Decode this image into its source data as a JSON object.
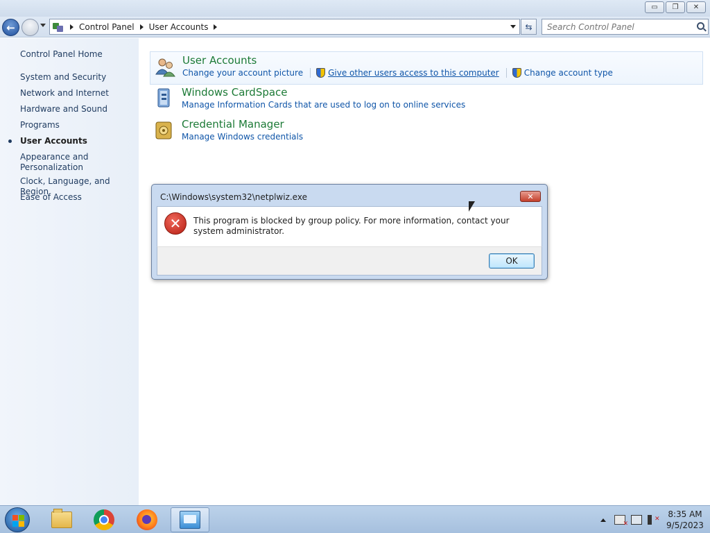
{
  "window": {
    "caption_buttons": {
      "minimize": "▭",
      "restore": "❐",
      "close": "✕"
    }
  },
  "navbar": {
    "breadcrumbs": [
      "Control Panel",
      "User Accounts"
    ],
    "search_placeholder": "Search Control Panel",
    "refresh_glyph": "⇆"
  },
  "sidebar": {
    "home": "Control Panel Home",
    "items": [
      {
        "label": "System and Security",
        "active": false
      },
      {
        "label": "Network and Internet",
        "active": false
      },
      {
        "label": "Hardware and Sound",
        "active": false
      },
      {
        "label": "Programs",
        "active": false
      },
      {
        "label": "User Accounts",
        "active": true
      },
      {
        "label": "Appearance and Personalization",
        "active": false
      },
      {
        "label": "Clock, Language, and Region",
        "active": false
      },
      {
        "label": "Ease of Access",
        "active": false
      }
    ]
  },
  "main": {
    "categories": [
      {
        "title": "User Accounts",
        "links": [
          "Change your account picture",
          "Give other users access to this computer",
          "Change account type"
        ]
      },
      {
        "title": "Windows CardSpace",
        "links": [
          "Manage Information Cards that are used to log on to online services"
        ]
      },
      {
        "title": "Credential Manager",
        "links": [
          "Manage Windows credentials"
        ]
      }
    ]
  },
  "dialog": {
    "title": "C:\\Windows\\system32\\netplwiz.exe",
    "message": "This program is blocked by group policy. For more information, contact your system administrator.",
    "ok_label": "OK",
    "close_glyph": "✕",
    "error_glyph": "✕"
  },
  "taskbar": {
    "apps": [
      "windows-explorer",
      "google-chrome",
      "firefox",
      "control-panel"
    ],
    "clock_time": "8:35 AM",
    "clock_date": "9/5/2023"
  },
  "colors": {
    "category_title": "#1c7a36",
    "link": "#0f55a8",
    "sidebar_bg": "#eef3fa",
    "dialog_frame": "#c9daf0"
  }
}
